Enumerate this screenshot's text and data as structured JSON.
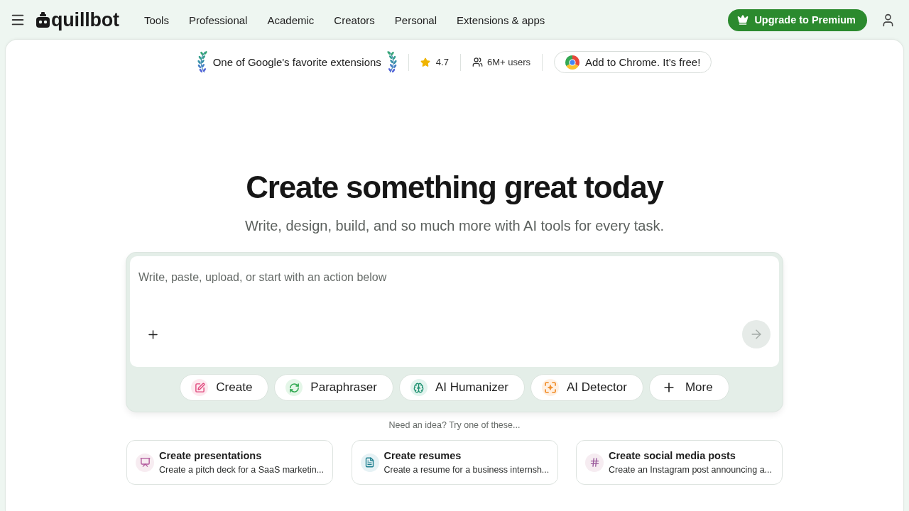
{
  "nav": {
    "logo": "quillbot",
    "links": [
      "Tools",
      "Professional",
      "Academic",
      "Creators",
      "Personal",
      "Extensions & apps"
    ],
    "upgrade_button": "Upgrade to Premium"
  },
  "promo_bar": {
    "award": "One of Google's favorite extensions",
    "rating": "4.7",
    "users": "6M+ users",
    "chrome_button": "Add to Chrome. It’s free!"
  },
  "hero": {
    "title": "Create something great today",
    "subtitle": "Write, design, build, and so much more with AI tools for every task."
  },
  "prompt": {
    "placeholder": "Write, paste, upload, or start with an action below",
    "actions": [
      {
        "kind": "create",
        "label": "Create"
      },
      {
        "kind": "paraphraser",
        "label": "Paraphraser"
      },
      {
        "kind": "humanizer",
        "label": "AI Humanizer"
      },
      {
        "kind": "detector",
        "label": "AI Detector"
      },
      {
        "kind": "more",
        "label": "More"
      }
    ]
  },
  "ideas": {
    "hint": "Need an idea? Try one of these...",
    "cards": [
      {
        "kind": "presentation",
        "title": "Create presentations",
        "description": "Create a pitch deck for a SaaS marketin..."
      },
      {
        "kind": "resume",
        "title": "Create resumes",
        "description": "Create a resume for a business internsh..."
      },
      {
        "kind": "social",
        "title": "Create social media posts",
        "description": "Create an Instagram post announcing a..."
      }
    ]
  }
}
